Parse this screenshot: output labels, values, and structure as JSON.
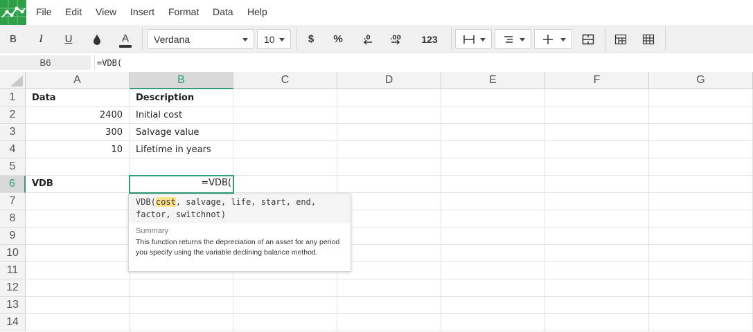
{
  "menubar": {
    "items": [
      "File",
      "Edit",
      "View",
      "Insert",
      "Format",
      "Data",
      "Help"
    ]
  },
  "toolbar": {
    "bold": "B",
    "italic": "I",
    "underline": "U",
    "text_color": "A",
    "font_family": "Verdana",
    "font_size": "10",
    "currency": "$",
    "percent": "%",
    "number_format": "123"
  },
  "formula_bar": {
    "cell_ref": "B6",
    "formula": "=VDB("
  },
  "sheet": {
    "columns": [
      "A",
      "B",
      "C",
      "D",
      "E",
      "F",
      "G"
    ],
    "active_column": "B",
    "rows": [
      "1",
      "2",
      "3",
      "4",
      "5",
      "6",
      "7",
      "8",
      "9",
      "10",
      "11",
      "12",
      "13",
      "14"
    ],
    "active_row": "6",
    "cells": {
      "A1": "Data",
      "B1": "Description",
      "A2": "2400",
      "B2": "Initial cost",
      "A3": "300",
      "B3": "Salvage value",
      "A4": "10",
      "B4": "Lifetime in years",
      "A6": "VDB",
      "B6": "=VDB("
    }
  },
  "tooltip": {
    "sig_prefix": "VDB(",
    "sig_highlight": "cost",
    "sig_rest": ", salvage, life, start, end, factor, switchnot)",
    "summary_heading": "Summary",
    "summary_text": "This function returns the depreciation of an asset for any period you specify using the variable declining balance method."
  },
  "colors": {
    "accent": "#2e9e74",
    "logo": "#2e9e48",
    "highlight": "#ffe08a"
  },
  "icons": [
    "logo-icon",
    "fill-color-icon",
    "decrease-decimals-icon",
    "increase-decimals-icon",
    "borders-icon",
    "align-icon",
    "vertical-align-icon",
    "merge-icon",
    "freeze-icon",
    "table-icon"
  ]
}
